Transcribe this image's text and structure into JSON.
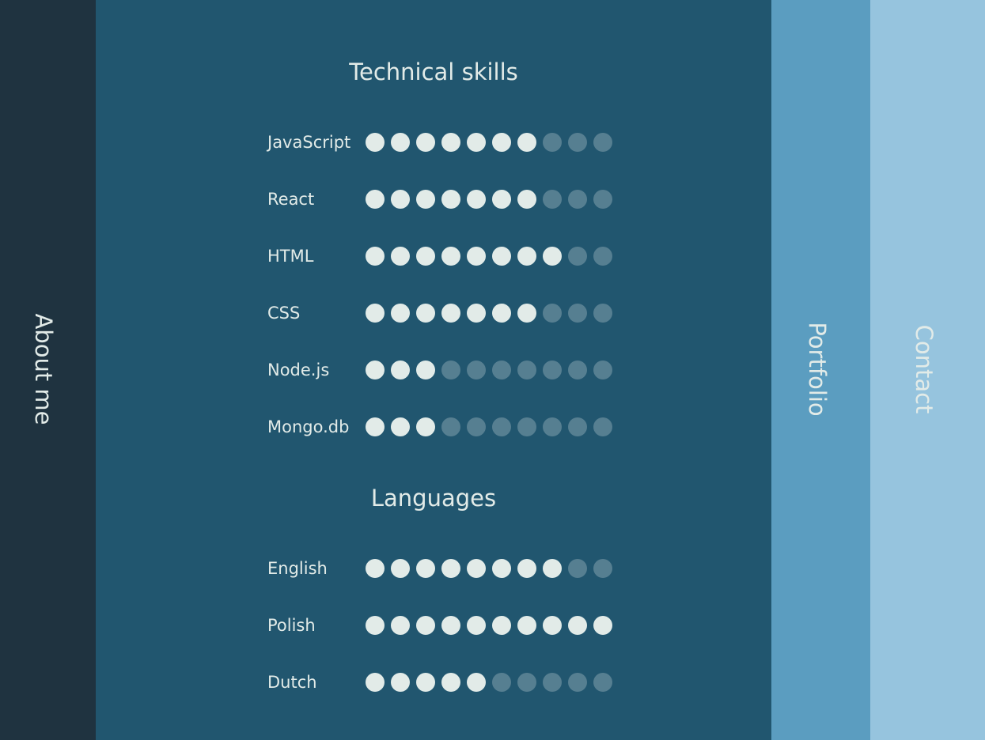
{
  "nav": {
    "about": "About me",
    "portfolio": "Portfolio",
    "contact": "Contact"
  },
  "technical": {
    "title": "Technical skills",
    "max": 10,
    "items": [
      {
        "label": "JavaScript",
        "level": 7
      },
      {
        "label": "React",
        "level": 7
      },
      {
        "label": "HTML",
        "level": 8
      },
      {
        "label": "CSS",
        "level": 7
      },
      {
        "label": "Node.js",
        "level": 3
      },
      {
        "label": "Mongo.db",
        "level": 3
      }
    ]
  },
  "languages": {
    "title": "Languages",
    "max": 10,
    "items": [
      {
        "label": "English",
        "level": 8
      },
      {
        "label": "Polish",
        "level": 10
      },
      {
        "label": "Dutch",
        "level": 5
      }
    ]
  },
  "colors": {
    "about_panel": "#1f3340",
    "main_panel": "#21566f",
    "portfolio_panel": "#5b9dc0",
    "contact_panel": "#96c4de",
    "dot_on": "#e2ebe8"
  }
}
